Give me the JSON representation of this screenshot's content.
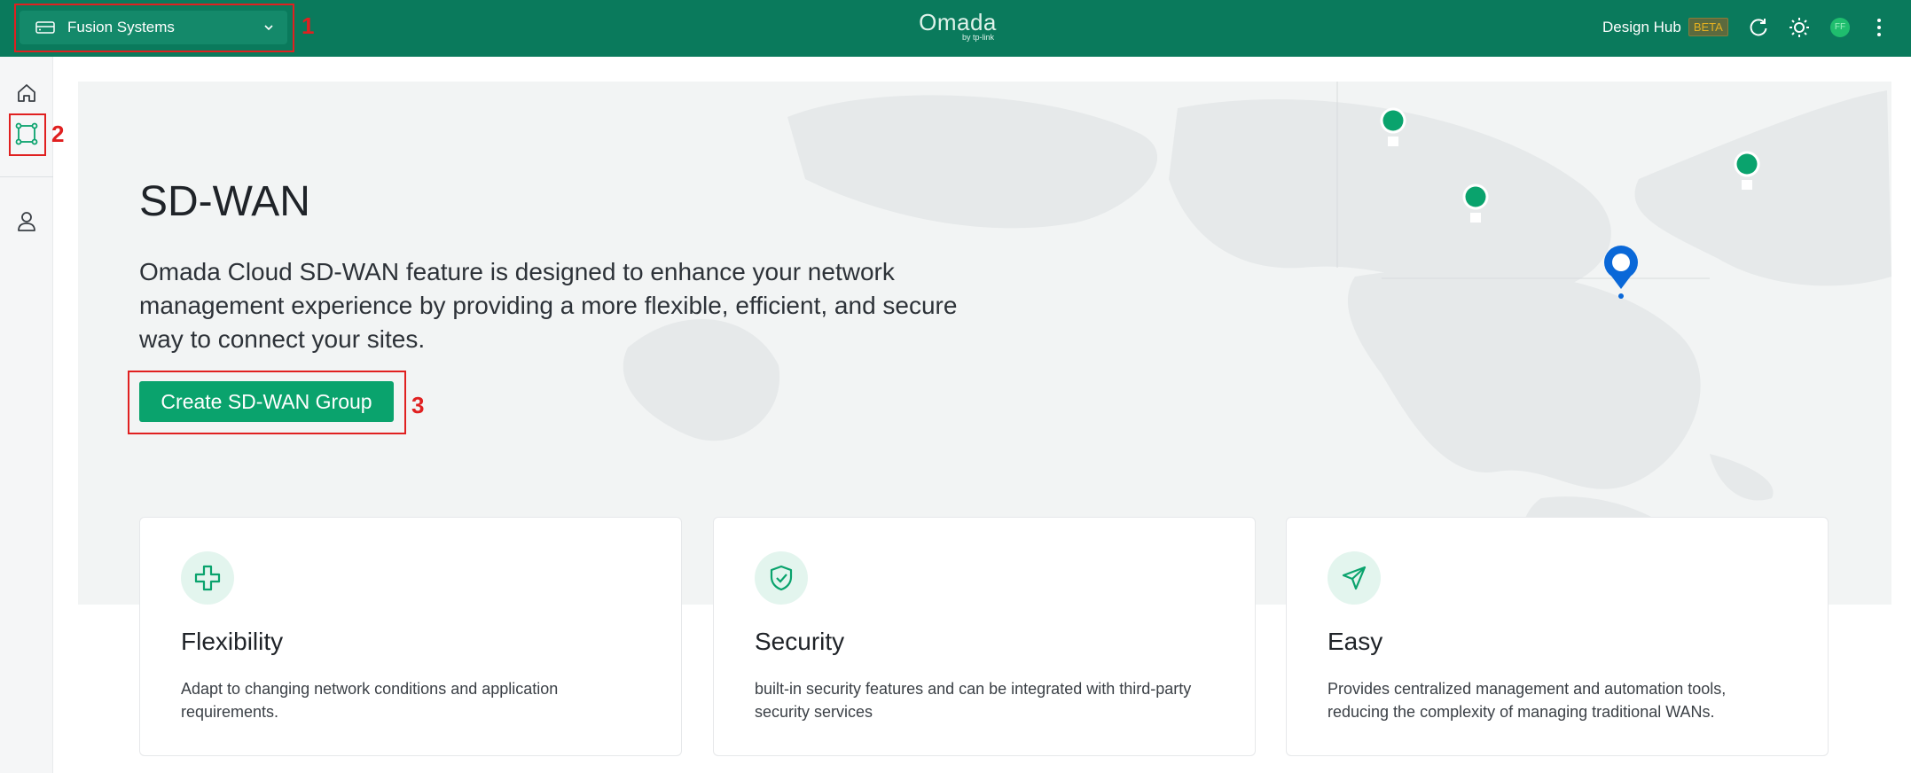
{
  "header": {
    "site_name": "Fusion Systems",
    "logo_main": "Omada",
    "logo_sub": "by tp-link",
    "design_hub_label": "Design Hub",
    "beta_badge": "BETA",
    "avatar_initials": "FF"
  },
  "annotations": [
    "1",
    "2",
    "3"
  ],
  "hero": {
    "title": "SD-WAN",
    "description": "Omada Cloud SD-WAN feature is designed to enhance your network management experience by providing a more flexible, efficient, and secure way to connect your sites.",
    "create_button": "Create SD-WAN Group"
  },
  "cards": [
    {
      "icon": "flexibility-icon",
      "title": "Flexibility",
      "text": "Adapt to changing network conditions and application requirements."
    },
    {
      "icon": "shield-check-icon",
      "title": "Security",
      "text": "built-in security features and can be integrated with third-party security services"
    },
    {
      "icon": "send-arrow-icon",
      "title": "Easy",
      "text": "Provides centralized management and automation tools, reducing the complexity of managing traditional WANs."
    }
  ],
  "colors": {
    "topbar": "#0a7a5c",
    "accent": "#0aa36d",
    "annotation": "#e02020"
  }
}
